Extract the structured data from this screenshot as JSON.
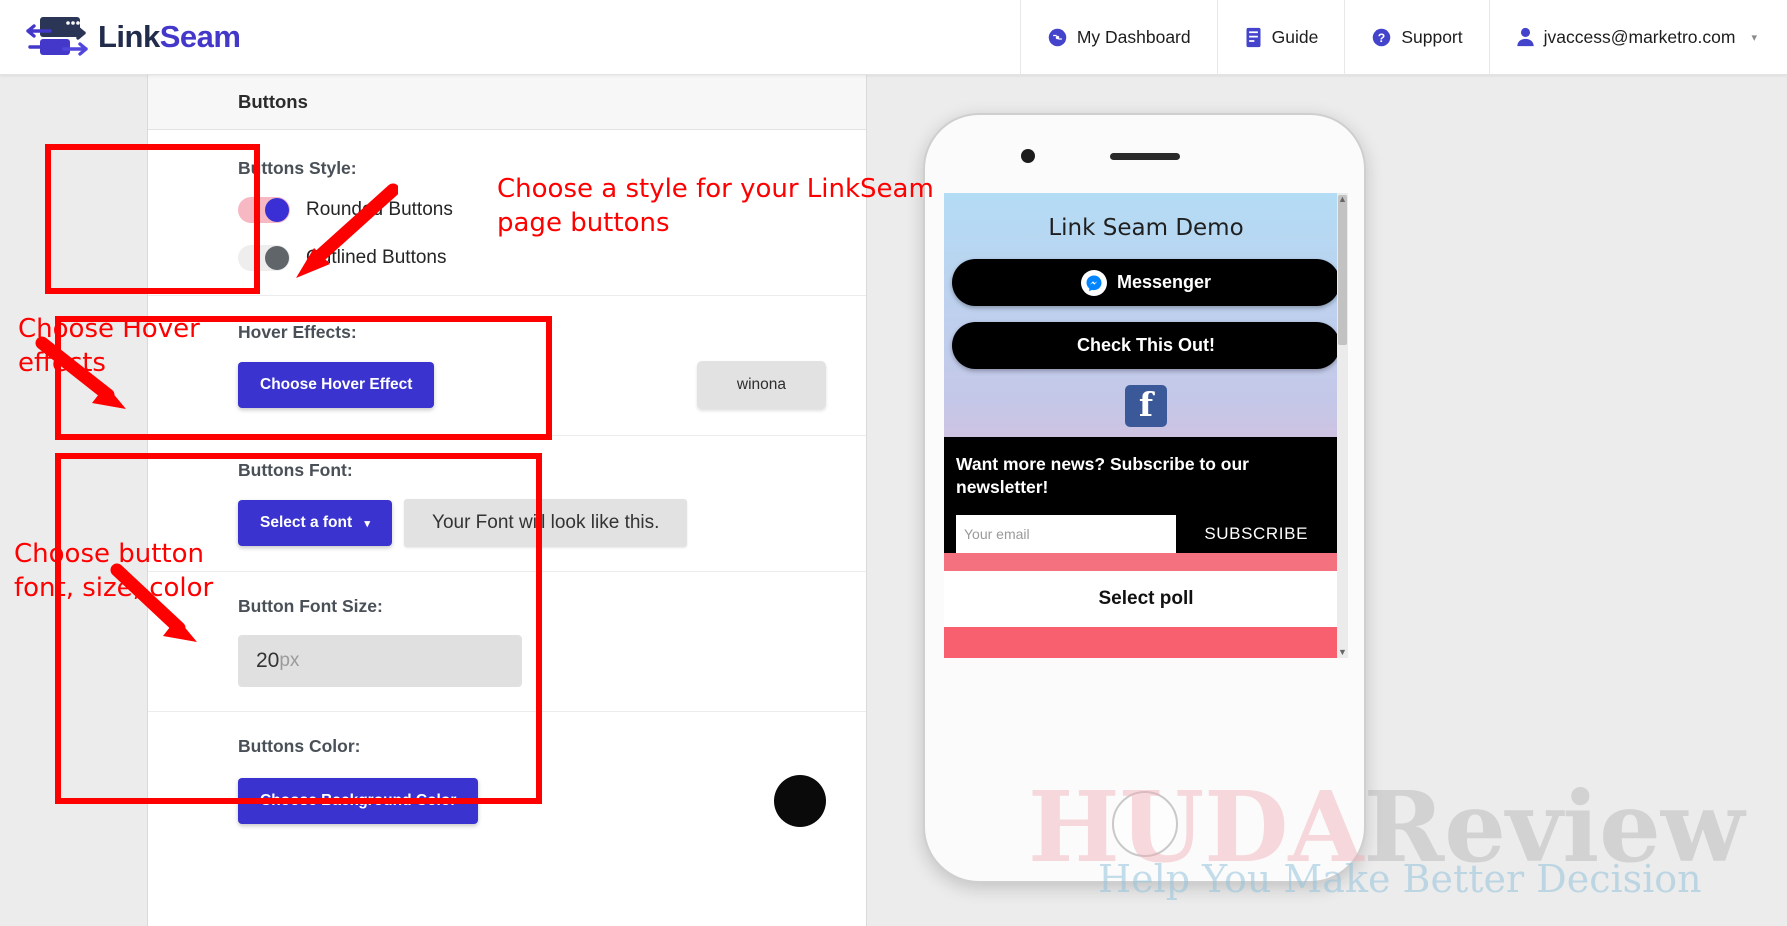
{
  "header": {
    "brand": {
      "part1": "Link",
      "part2": "Seam"
    },
    "nav": [
      {
        "label": "My Dashboard",
        "icon": "dashboard-icon"
      },
      {
        "label": "Guide",
        "icon": "book-icon"
      },
      {
        "label": "Support",
        "icon": "question-circle-icon"
      }
    ],
    "account": {
      "label": "jvaccess@marketro.com",
      "icon": "user-icon",
      "caret": "▾"
    }
  },
  "panel": {
    "title": "Buttons",
    "buttons_style": {
      "label": "Buttons Style:",
      "options": [
        {
          "label": "Rounded Buttons",
          "state": "on"
        },
        {
          "label": "Outlined Buttons",
          "state": "off"
        }
      ]
    },
    "hover_effects": {
      "label": "Hover Effects:",
      "button": "Choose Hover Effect",
      "preview": "winona"
    },
    "buttons_font": {
      "label": "Buttons Font:",
      "select_button": "Select a font",
      "select_caret": "▾",
      "preview": "Your Font will look like this."
    },
    "font_size": {
      "label": "Button Font Size:",
      "value": "20",
      "unit": "px"
    },
    "buttons_color": {
      "label": "Buttons Color:",
      "button": "Choose Background Color",
      "swatch_color": "#0a0a0a"
    }
  },
  "annotations": [
    {
      "text": "Choose a style for your LinkSeam\npage buttons"
    },
    {
      "text": "Choose Hover\neffects"
    },
    {
      "text": "Choose button\nfont, size, color"
    }
  ],
  "preview": {
    "page_title": "Link Seam Demo",
    "buttons": [
      {
        "label": "Messenger",
        "icon": "messenger-icon"
      },
      {
        "label": "Check This Out!",
        "icon": ""
      }
    ],
    "social_icon": "facebook-icon",
    "newsletter": {
      "title": "Want more news? Subscribe to our newsletter!",
      "input_placeholder": "Your email",
      "subscribe_label": "SUBSCRIBE"
    },
    "poll_label": "Select poll"
  },
  "watermark": {
    "part1": "HUDA",
    "part2": "Review",
    "tagline": "Help You Make Better Decision"
  }
}
